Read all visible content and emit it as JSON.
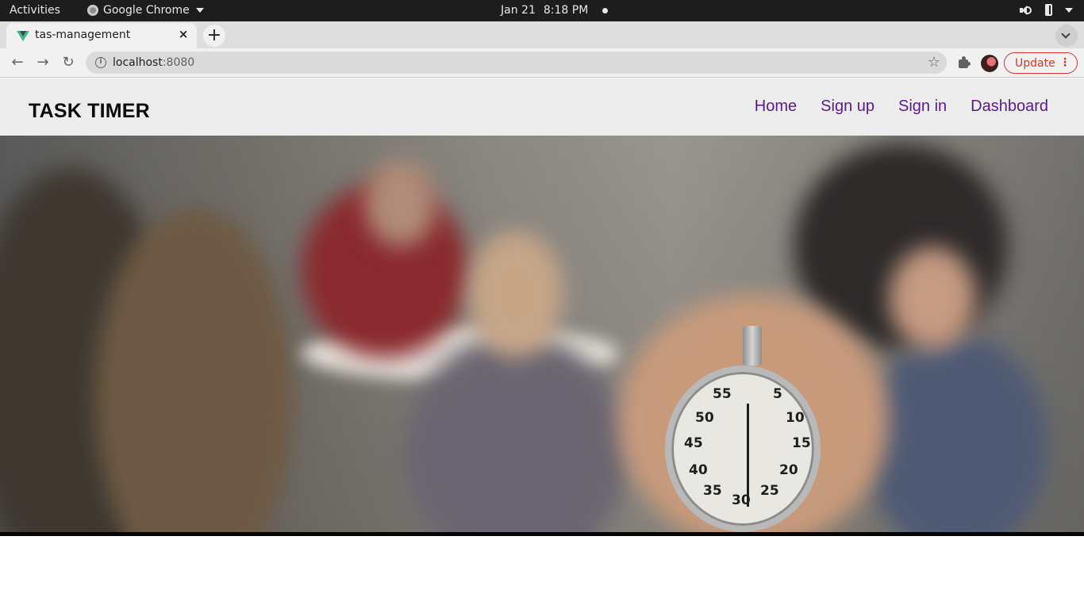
{
  "system_bar": {
    "activities": "Activities",
    "app_name": "Google Chrome",
    "date": "Jan 21",
    "time": "8:18 PM"
  },
  "browser": {
    "tab_title": "tas-management",
    "tab_close": "×",
    "new_tab": "+",
    "url_host": "localhost",
    "url_port": ":8080",
    "update_label": "Update"
  },
  "site": {
    "brand": "TASK TIMER",
    "nav": [
      "Home",
      "Sign up",
      "Sign in",
      "Dashboard"
    ]
  },
  "hero": {
    "stopwatch_numbers": [
      "55",
      "5",
      "50",
      "10",
      "45",
      "15",
      "40",
      "20",
      "35",
      "25",
      "30"
    ]
  },
  "colors": {
    "nav_link": "#5a1a8b",
    "header_bg": "#ececec",
    "update_accent": "#d93025"
  }
}
